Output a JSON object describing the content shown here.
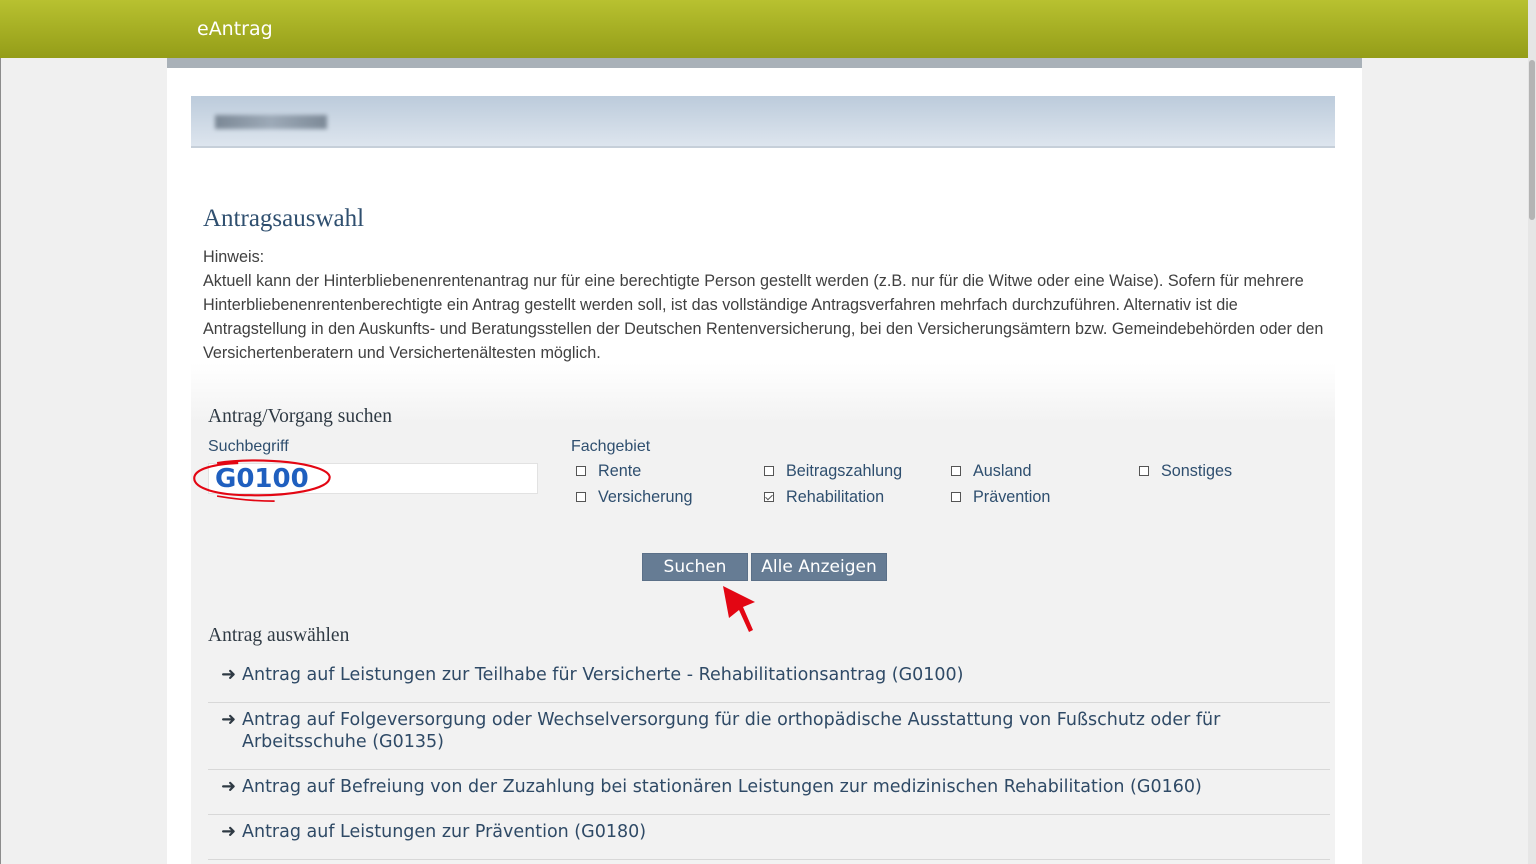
{
  "app": {
    "title": "eAntrag"
  },
  "colors": {
    "header": "#a4ad22",
    "button": "#667c94",
    "annotation": "#e30613"
  },
  "page": {
    "heading": "Antragsauswahl",
    "hint_label": "Hinweis:",
    "hint_text": "Aktuell kann der Hinterbliebenenrentenantrag nur für eine berechtigte Person gestellt werden (z.B. nur für die Witwe oder eine Waise). Sofern für mehrere Hinterbliebenenrentenberechtigte ein Antrag gestellt werden soll, ist das vollständige Antragsverfahren mehrfach durchzuführen. Alternativ ist die Antragstellung in den Auskunfts- und Beratungsstellen der Deutschen Rentenversicherung, bei den Versicherungsämtern bzw. Gemeindebehörden oder den Versichertenberatern und Versichertenältesten möglich."
  },
  "search": {
    "heading": "Antrag/Vorgang suchen",
    "term_label": "Suchbegriff",
    "term_value": "G0100",
    "field_label": "Fachgebiet",
    "checkboxes": [
      {
        "label": "Rente",
        "checked": false
      },
      {
        "label": "Beitragszahlung",
        "checked": false
      },
      {
        "label": "Ausland",
        "checked": false
      },
      {
        "label": "Sonstiges",
        "checked": false
      },
      {
        "label": "Versicherung",
        "checked": false
      },
      {
        "label": "Rehabilitation",
        "checked": true
      },
      {
        "label": "Prävention",
        "checked": false
      }
    ],
    "search_button": "Suchen",
    "show_all_button": "Alle Anzeigen"
  },
  "results": {
    "heading": "Antrag auswählen",
    "items": [
      {
        "label": "Antrag auf Leistungen zur Teilhabe für Versicherte - Rehabilitationsantrag (G0100)"
      },
      {
        "label": "Antrag auf Folgeversorgung oder Wechselversorgung für die orthopädische Ausstattung von Fußschutz oder für Arbeitsschuhe (G0135)"
      },
      {
        "label": "Antrag auf Befreiung von der Zuzahlung bei stationären Leistungen zur medizinischen Rehabilitation (G0160)"
      },
      {
        "label": "Antrag auf Leistungen zur Prävention (G0180)"
      }
    ]
  }
}
